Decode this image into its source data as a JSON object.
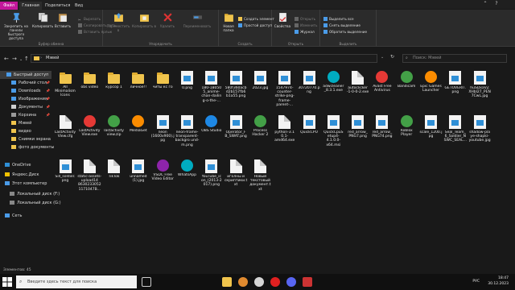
{
  "ribbon": {
    "tabs": {
      "file": "Файл",
      "home": "Главная",
      "share": "Поделиться",
      "view": "Вид"
    },
    "clipboard": {
      "pin": "Закрепить на панели быстрого доступа",
      "copy": "Копировать",
      "paste": "Вставить",
      "cut": "Вырезать",
      "copy_path": "Скопировать путь",
      "paste_shortcut": "Вставить ярлык",
      "label": "Буфер обмена"
    },
    "organize": {
      "move_to": "Переместить в",
      "copy_to": "Копировать в",
      "delete": "Удалить",
      "rename": "Переименовать",
      "label": "Упорядочить"
    },
    "new": {
      "new_folder": "Новая папка",
      "new_item": "Создать элемент",
      "easy_access": "Простой доступ",
      "label": "Создать"
    },
    "open": {
      "properties": "Свойства",
      "open": "Открыть",
      "edit": "Изменить",
      "history": "Журнал",
      "label": "Открыть"
    },
    "select": {
      "select_all": "Выделить все",
      "select_none": "Снять выделение",
      "invert": "Обратить выделение",
      "label": "Выделить"
    }
  },
  "address": {
    "path": "Мэвей",
    "search_placeholder": "Поиск: Мэвей"
  },
  "sidebar": {
    "items": [
      {
        "label": "Быстрый доступ",
        "pinned": false
      },
      {
        "label": "Рабочий стол",
        "pinned": true
      },
      {
        "label": "Downloads",
        "pinned": true
      },
      {
        "label": "Изображения",
        "pinned": true
      },
      {
        "label": "Документы",
        "pinned": true
      },
      {
        "label": "Корзина",
        "pinned": true
      },
      {
        "label": "Мэвей",
        "pinned": false
      },
      {
        "label": "видео",
        "pinned": false
      },
      {
        "label": "Снимки экрана",
        "pinned": false
      },
      {
        "label": "фото документы",
        "pinned": false
      },
      {
        "label": "OneDrive",
        "pinned": false
      },
      {
        "label": "Яндекс.Диск",
        "pinned": false
      },
      {
        "label": "Этот компьютер",
        "pinned": false
      },
      {
        "label": "Локальный диск (F:)",
        "pinned": false
      },
      {
        "label": "Локальный диск (G:)",
        "pinned": false
      },
      {
        "label": "Сеть",
        "pinned": false
      }
    ]
  },
  "files": [
    {
      "name": "All Minimalism Icons",
      "type": "folder"
    },
    {
      "name": "obs video",
      "type": "folder"
    },
    {
      "name": "курсор 1",
      "type": "folder"
    },
    {
      "name": "личное!!",
      "type": "folder"
    },
    {
      "name": "читы кс го",
      "type": "folder"
    },
    {
      "name": "0.png",
      "type": "image"
    },
    {
      "name": "180-18050 5_anime-chan-dailin g-o-the-...",
      "type": "image"
    },
    {
      "name": "580f360acb d2b157fb6 b1a55.png",
      "type": "image"
    },
    {
      "name": "2023.jpg",
      "type": "image"
    },
    {
      "name": "1547974-counter-strike-png-frame-parent-...",
      "type": "image"
    },
    {
      "name": "30720770.png",
      "type": "image"
    },
    {
      "name": "adwcleaner _8.3.1.exe",
      "type": "app"
    },
    {
      "name": "autoclicker -1-0-0-2.exe",
      "type": "doc"
    },
    {
      "name": "Avast Free Antivirus",
      "type": "app"
    },
    {
      "name": "Bandicam",
      "type": "app"
    },
    {
      "name": "Epic Games Launcher",
      "type": "app"
    },
    {
      "name": "GETOVERIT. png",
      "type": "image"
    },
    {
      "name": "huSDxaVZ XHbl27_PEN7CwL.jpg",
      "type": "image"
    },
    {
      "name": "LastActivity View.cfg",
      "type": "doc"
    },
    {
      "name": "LastActivity View.exe",
      "type": "app"
    },
    {
      "name": "lastactivity view.zip",
      "type": "app"
    },
    {
      "name": "MediaGet",
      "type": "app"
    },
    {
      "name": "neon (1600x900).jpg",
      "type": "image"
    },
    {
      "name": "neon-frame-transparent-backgro und-m.png",
      "type": "image"
    },
    {
      "name": "OBS Studio",
      "type": "app"
    },
    {
      "name": "Operator_F B_SWAT.png",
      "type": "image"
    },
    {
      "name": "Process Hacker 2",
      "type": "app"
    },
    {
      "name": "python-3.1 0.1-amd64.exe",
      "type": "doc"
    },
    {
      "name": "QuickCPU",
      "type": "image"
    },
    {
      "name": "QuickCpuS etup4-4.1.0.0-x64.msi",
      "type": "image"
    },
    {
      "name": "red_arrow_ PNG7.png",
      "type": "image"
    },
    {
      "name": "red_arrow_ PNG74.png",
      "type": "image"
    },
    {
      "name": "Roblox Player",
      "type": "app"
    },
    {
      "name": "scale_1200.jpg",
      "type": "image"
    },
    {
      "name": "Seal_Team_ 6_Soldier_N SWC_SEAL...",
      "type": "image"
    },
    {
      "name": "shadow-pla ye-shapki-youtube.jpg",
      "type": "image"
    },
    {
      "name": "Sill_soldier. png",
      "type": "image"
    },
    {
      "name": "static-assets-upload14 86302330521171047B...",
      "type": "doc"
    },
    {
      "name": "TikTok",
      "type": "doc"
    },
    {
      "name": "unnamed (1).jpg",
      "type": "image"
    },
    {
      "name": "VSDC Free Video Editor",
      "type": "app"
    },
    {
      "name": "WhatsApp",
      "type": "app"
    },
    {
      "name": "YouTube_ic on_(2013-2 017).png",
      "type": "image"
    },
    {
      "name": "иголны и скриптики.txt",
      "type": "doc"
    },
    {
      "name": "Новый текстовый документ.t xt",
      "type": "doc"
    }
  ],
  "statusbar": {
    "count": "Элементов: 45"
  },
  "taskbar": {
    "search_placeholder": "Введите здесь текст для поиска",
    "lang": "РУС",
    "time": "18:47",
    "date": "30.12.2023"
  },
  "colors": {
    "accent": "#c3179b",
    "folder": "#f0c44c",
    "bg": "#191919"
  }
}
